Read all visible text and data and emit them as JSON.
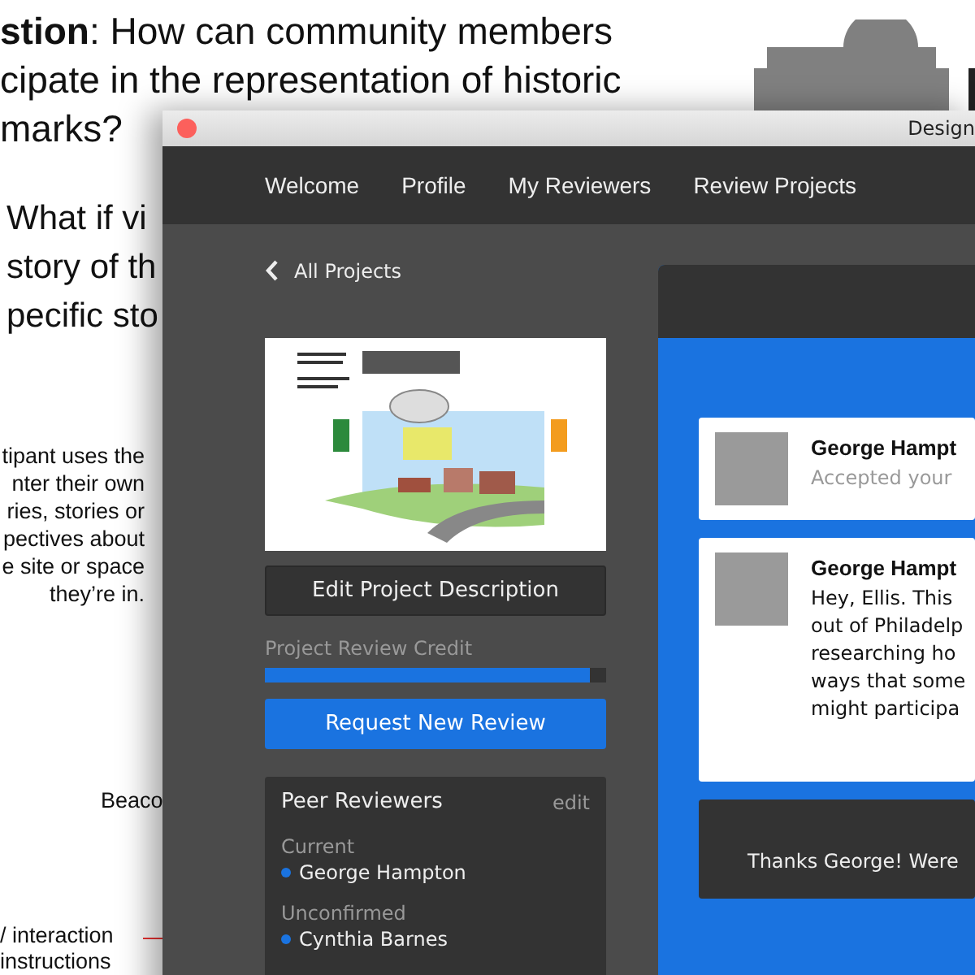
{
  "background_document": {
    "question_lines": [
      "**stion**: How can community members",
      "cipate in the representation of historic",
      "marks?"
    ],
    "idea_lines": [
      "What if vi",
      "story of th",
      "pecific sto"
    ],
    "caption_lines": [
      "tipant uses the",
      "nter their own",
      "ries, stories or",
      "pectives about",
      "e site or space",
      "they’re in."
    ],
    "beacon_label": "Beaco",
    "interaction_lines": [
      "/ interaction",
      "instructions"
    ]
  },
  "window": {
    "title": "Design"
  },
  "nav": [
    {
      "label": "Welcome"
    },
    {
      "label": "Profile"
    },
    {
      "label": "My Reviewers"
    },
    {
      "label": "Review Projects"
    }
  ],
  "back_link": "All Projects",
  "edit_button": "Edit Project Description",
  "credit": {
    "label": "Project Review Credit",
    "level": 0.95
  },
  "request_button": "Request New Review",
  "peer_reviewers": {
    "title": "Peer Reviewers",
    "edit": "edit",
    "groups": [
      {
        "heading": "Current",
        "names": [
          "George Hampton"
        ]
      },
      {
        "heading": "Unconfirmed",
        "names": [
          "Cynthia Barnes"
        ]
      }
    ]
  },
  "messages": [
    {
      "kind": "notice",
      "name": "George Hampt",
      "lines": [
        "Accepted your"
      ]
    },
    {
      "kind": "message",
      "name": "George Hampt",
      "lines": [
        "Hey, Ellis. This",
        "out of Philadelp",
        "researching ho",
        "ways that some",
        "might participa"
      ]
    },
    {
      "kind": "reply",
      "lines": [
        "Thanks George! Were"
      ]
    }
  ]
}
